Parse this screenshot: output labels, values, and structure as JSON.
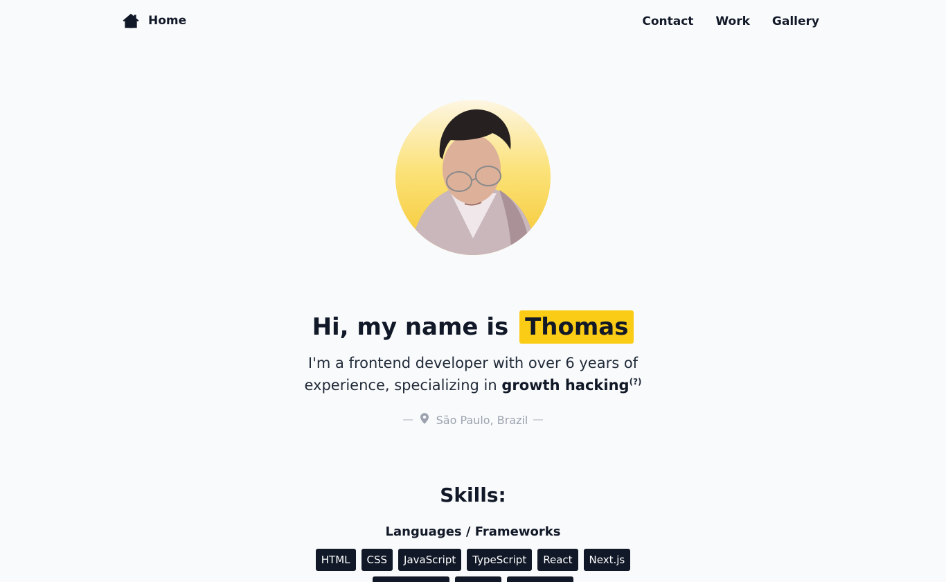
{
  "nav": {
    "home_label": "Home",
    "links": [
      "Contact",
      "Work",
      "Gallery"
    ],
    "home_icon": "home-icon"
  },
  "hero": {
    "greeting": "Hi, my name is",
    "name": "Thomas",
    "intro_prefix": "I'm a frontend developer with over 6 years of experience, specializing in",
    "intro_bold": "growth hacking",
    "intro_footnote": "(?)",
    "location": "São Paulo, Brazil",
    "location_icon": "map-pin-icon"
  },
  "skills": {
    "title": "Skills:",
    "category": "Languages / Frameworks",
    "tags": [
      "HTML",
      "CSS",
      "JavaScript",
      "TypeScript",
      "React",
      "Next.js"
    ]
  },
  "colors": {
    "accent": "#facc15",
    "tag_bg": "#111827",
    "text": "#111827",
    "muted": "#9ca3af"
  }
}
